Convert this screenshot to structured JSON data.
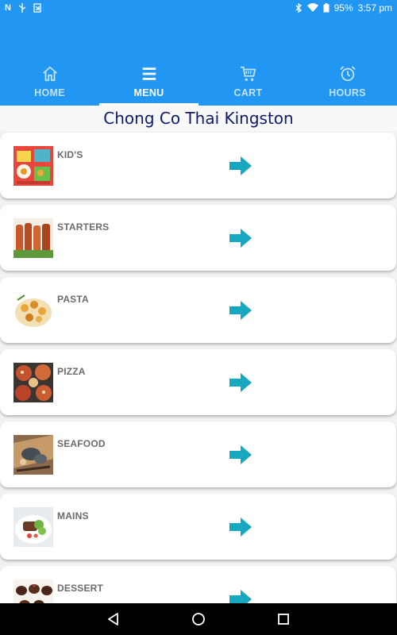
{
  "status_bar": {
    "left_icons": [
      "n-icon",
      "usb-icon",
      "download-icon"
    ],
    "battery": "95%",
    "time": "3:57 pm"
  },
  "tabs": [
    {
      "label": "HOME",
      "icon": "home-icon",
      "active": false
    },
    {
      "label": "MENU",
      "icon": "menu-icon",
      "active": true
    },
    {
      "label": "CART",
      "icon": "cart-icon",
      "active": false
    },
    {
      "label": "HOURS",
      "icon": "alarm-clock-icon",
      "active": false
    }
  ],
  "restaurant_name": "Chong Co Thai Kingston",
  "categories": [
    {
      "label": "KID'S",
      "image": "kids-meal-photo"
    },
    {
      "label": "STARTERS",
      "image": "skewers-photo"
    },
    {
      "label": "PASTA",
      "image": "pasta-photo"
    },
    {
      "label": "PIZZA",
      "image": "pizza-photo"
    },
    {
      "label": "SEAFOOD",
      "image": "seafood-photo"
    },
    {
      "label": "MAINS",
      "image": "steak-salad-photo"
    },
    {
      "label": "DESSERT",
      "image": "chocolate-dessert-photo"
    }
  ],
  "colors": {
    "primary": "#2196f3",
    "title_text": "#0d1b6e",
    "arrow": "#17a8bf",
    "label_text": "#6b6b6b"
  }
}
